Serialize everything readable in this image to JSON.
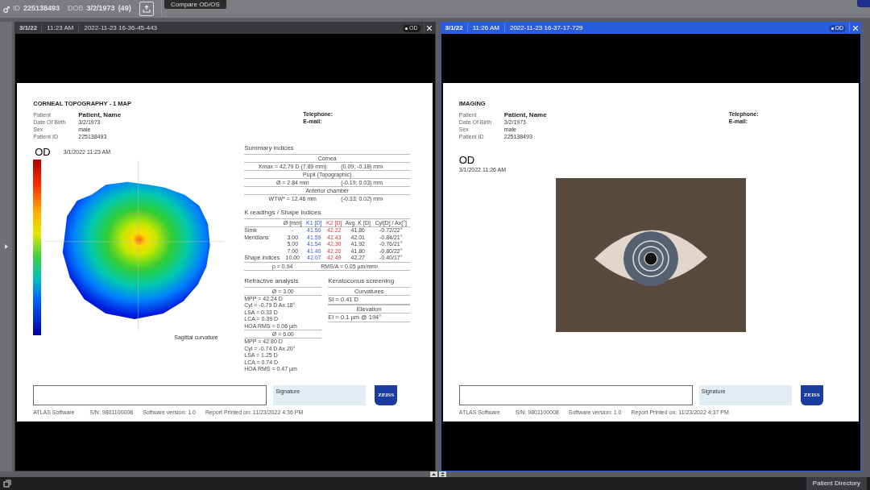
{
  "top_bar": {
    "id_label": "ID",
    "patient_id": "225138493",
    "dob_label": "DOB",
    "dob": "3/2/1973",
    "age": "(49)",
    "tooltip": "Compare OD/OS"
  },
  "panels": [
    {
      "selected": false,
      "date": "3/1/22",
      "time": "11:23 AM",
      "timestamp": "2022-11-23 16-36-45-443",
      "eye": "OD",
      "report": {
        "kind": "topography",
        "title": "CORNEAL TOPOGRAPHY - 1 MAP",
        "patient_fields": [
          {
            "label": "Patient",
            "value": "Patient, Name"
          },
          {
            "label": "Date Of Birth",
            "value": "3/2/1973"
          },
          {
            "label": "Sex",
            "value": "male"
          },
          {
            "label": "Patient ID",
            "value": "225138493"
          }
        ],
        "contact": [
          "Telephone:",
          "E-mail:"
        ],
        "eye": "OD",
        "exam_datetime": "3/1/2022 11:23 AM",
        "map_caption": "Sagittal curvature",
        "summary": {
          "title": "Summary indices",
          "groups": [
            {
              "name": "Cornea",
              "value": "Kmax = 42.79 D (7.89 mm)",
              "position": "(0.09; -0.18) mm"
            },
            {
              "name": "Pupil (Topographic)",
              "value": "Ø = 2.84 mm",
              "position": "(-0.19; 0.03) mm"
            },
            {
              "name": "Anterior chamber",
              "value": "WTW* = 12.46 mm",
              "position": "(-0.33; 0.02) mm"
            }
          ]
        },
        "k_readings": {
          "title": "K readings / Shape indices",
          "columns": [
            "",
            "Ø [mm]",
            "K1 [D]",
            "K2 [D]",
            "Avg. K [D]",
            "Cyl[D] / Ax[°]"
          ],
          "rows": [
            [
              "Simk",
              "-",
              "41.50",
              "42.22",
              "41.86",
              "-0.72/22°"
            ],
            [
              "Meridians",
              "3.00",
              "41.59",
              "42.43",
              "42.01",
              "-0.84/21°"
            ],
            [
              "",
              "5.00",
              "41.54",
              "42.30",
              "41.92",
              "-0.76/21°"
            ],
            [
              "",
              "7.00",
              "41.40",
              "42.20",
              "41.80",
              "-0.80/22°"
            ],
            [
              "Shape indices",
              "10.00",
              "42.07",
              "42.49",
              "42.27",
              "-0.40/17°"
            ]
          ],
          "footer": [
            "p = 0.94",
            "RMS/A = 0.05 µm/mm²"
          ]
        },
        "refractive": {
          "title": "Refractive analysis",
          "groups": [
            {
              "name": "Ø = 3.00",
              "lines": [
                "MPP = 42.24 D",
                "Cyl = -0.79 D Ax 18°",
                "LSA = 0.33 D",
                "LCA = 0.39 D",
                "HOA RMS = 0.06 µm"
              ]
            },
            {
              "name": "Ø = 6.00",
              "lines": [
                "MPP = 42.80 D",
                "Cyl = -0.74 D Ax 20°",
                "LSA = 1.25 D",
                "LCA = 0.74 D",
                "HOA RMS = 0.47 µm"
              ]
            }
          ]
        },
        "keratoconus": {
          "title": "Keratoconus screening",
          "groups": [
            {
              "name": "Curvatures",
              "value": "SI  = 0.41 D"
            },
            {
              "name": "Elevation",
              "value": "EI  = 0.1 µm @ 194°"
            }
          ]
        },
        "signature": "Signature",
        "logo": "ZEISS",
        "footer": [
          "ATLAS Software",
          "S/N: 9801100008",
          "Software version: 1.0",
          "Report Printed on: 11/23/2022 4:36 PM"
        ]
      }
    },
    {
      "selected": true,
      "date": "3/1/22",
      "time": "11:26 AM",
      "timestamp": "2022-11-23 16-37-17-729",
      "eye": "OD",
      "report": {
        "kind": "imaging",
        "title": "IMAGING",
        "patient_fields": [
          {
            "label": "Patient",
            "value": "Patient, Name"
          },
          {
            "label": "Date Of Birth",
            "value": "3/2/1973"
          },
          {
            "label": "Sex",
            "value": "male"
          },
          {
            "label": "Patient ID",
            "value": "225138493"
          }
        ],
        "contact": [
          "Telephone:",
          "E-mail:"
        ],
        "eye": "OD",
        "exam_datetime": "3/1/2022 11:26 AM",
        "signature": "Signature",
        "logo": "ZEISS",
        "footer": [
          "ATLAS Software",
          "S/N: 9801100008",
          "Software version: 1.0",
          "Report Printed on: 11/23/2022 4:37 PM"
        ]
      }
    }
  ],
  "bottom_bar": {
    "button": "Patient Directory"
  }
}
